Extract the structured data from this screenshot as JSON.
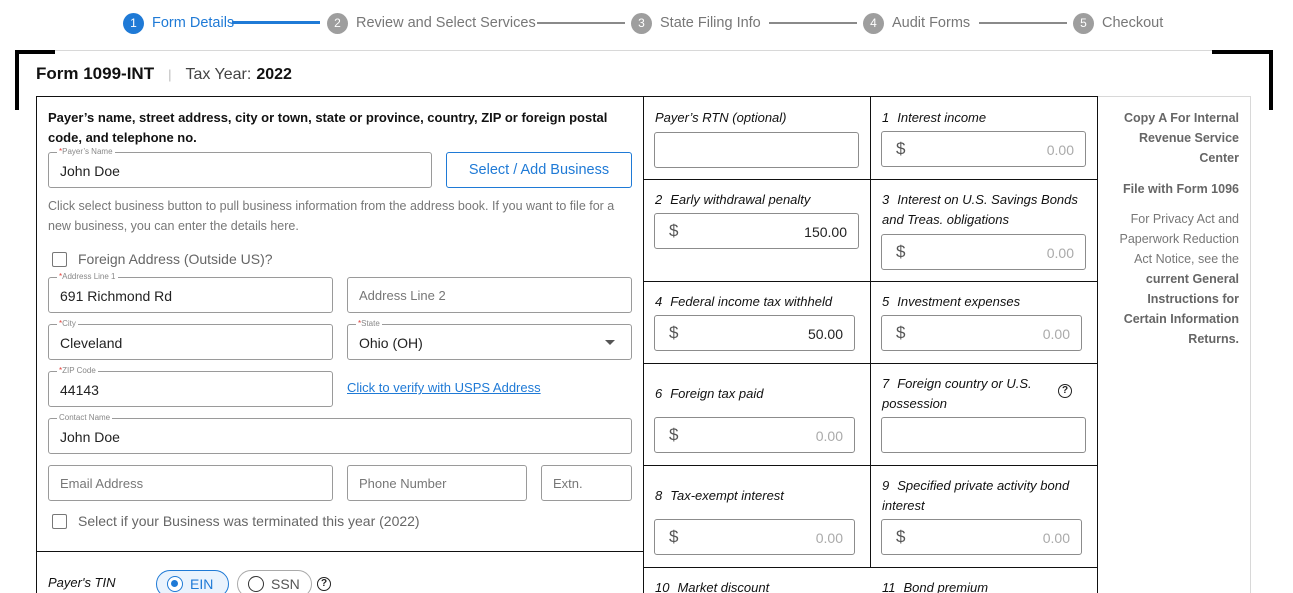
{
  "stepper": {
    "steps": [
      {
        "num": "1",
        "label": "Form Details"
      },
      {
        "num": "2",
        "label": "Review and Select Services"
      },
      {
        "num": "3",
        "label": "State Filing Info"
      },
      {
        "num": "4",
        "label": "Audit Forms"
      },
      {
        "num": "5",
        "label": "Checkout"
      }
    ],
    "active_step": 1,
    "accent_color": "#1f7ad6"
  },
  "header": {
    "form_name": "Form 1099-INT",
    "tax_year_label": "Tax Year:",
    "tax_year": "2022"
  },
  "payer": {
    "title": "Payer’s name, street address, city or town, state or province, country, ZIP or foreign postal code, and telephone no.",
    "name_label": "Payer’s Name",
    "name_value": "John Doe",
    "select_business_button": "Select / Add Business",
    "help_text": "Click select business button to pull business information from the address book. If you want to file for a new business, you can enter the details here.",
    "foreign_address_label": "Foreign Address (Outside US)?",
    "address1_label": "Address Line 1",
    "address1_value": "691 Richmond Rd",
    "address2_placeholder": "Address Line 2",
    "city_label": "City",
    "city_value": "Cleveland",
    "state_label": "State",
    "state_value": "Ohio (OH)",
    "zip_label": "ZIP Code",
    "zip_value": "44143",
    "usps_link": "Click to verify with USPS Address",
    "contact_label": "Contact Name",
    "contact_value": "John Doe",
    "email_placeholder": "Email Address",
    "phone_placeholder": "Phone Number",
    "ext_placeholder": "Extn.",
    "terminated_label": "Select if your Business was terminated this year (2022)",
    "tin_label": "Payer's TIN",
    "tin_options": [
      "EIN",
      "SSN"
    ],
    "tin_selected": "EIN"
  },
  "boxes": {
    "rtn": {
      "label": "Payer’s RTN (optional)",
      "value": ""
    },
    "b1": {
      "num": "1",
      "label": "Interest income",
      "value": "0.00",
      "filled": false
    },
    "b2": {
      "num": "2",
      "label": "Early withdrawal penalty",
      "value": "150.00",
      "filled": true
    },
    "b3": {
      "num": "3",
      "label": "Interest on U.S. Savings Bonds and Treas. obligations",
      "value": "0.00",
      "filled": false
    },
    "b4": {
      "num": "4",
      "label": "Federal income tax withheld",
      "value": "50.00",
      "filled": true
    },
    "b5": {
      "num": "5",
      "label": "Investment expenses",
      "value": "0.00",
      "filled": false
    },
    "b6": {
      "num": "6",
      "label": "Foreign tax paid",
      "value": "0.00",
      "filled": false
    },
    "b7": {
      "num": "7",
      "label": "Foreign country or U.S. possession",
      "value": ""
    },
    "b8": {
      "num": "8",
      "label": "Tax-exempt interest",
      "value": "0.00",
      "filled": false
    },
    "b9": {
      "num": "9",
      "label": "Specified private activity bond interest",
      "value": "0.00",
      "filled": false
    },
    "b10": {
      "num": "10",
      "label": "Market discount"
    },
    "b11": {
      "num": "11",
      "label": "Bond premium"
    },
    "currency_symbol": "$"
  },
  "copy_info": {
    "copy_a": "Copy A For Internal Revenue Service Center",
    "file_with": "File with Form 1096",
    "privacy_pre": "For Privacy Act and Paperwork Reduction Act Notice, see the",
    "privacy_bold": "current General Instructions for Certain Information Returns."
  }
}
